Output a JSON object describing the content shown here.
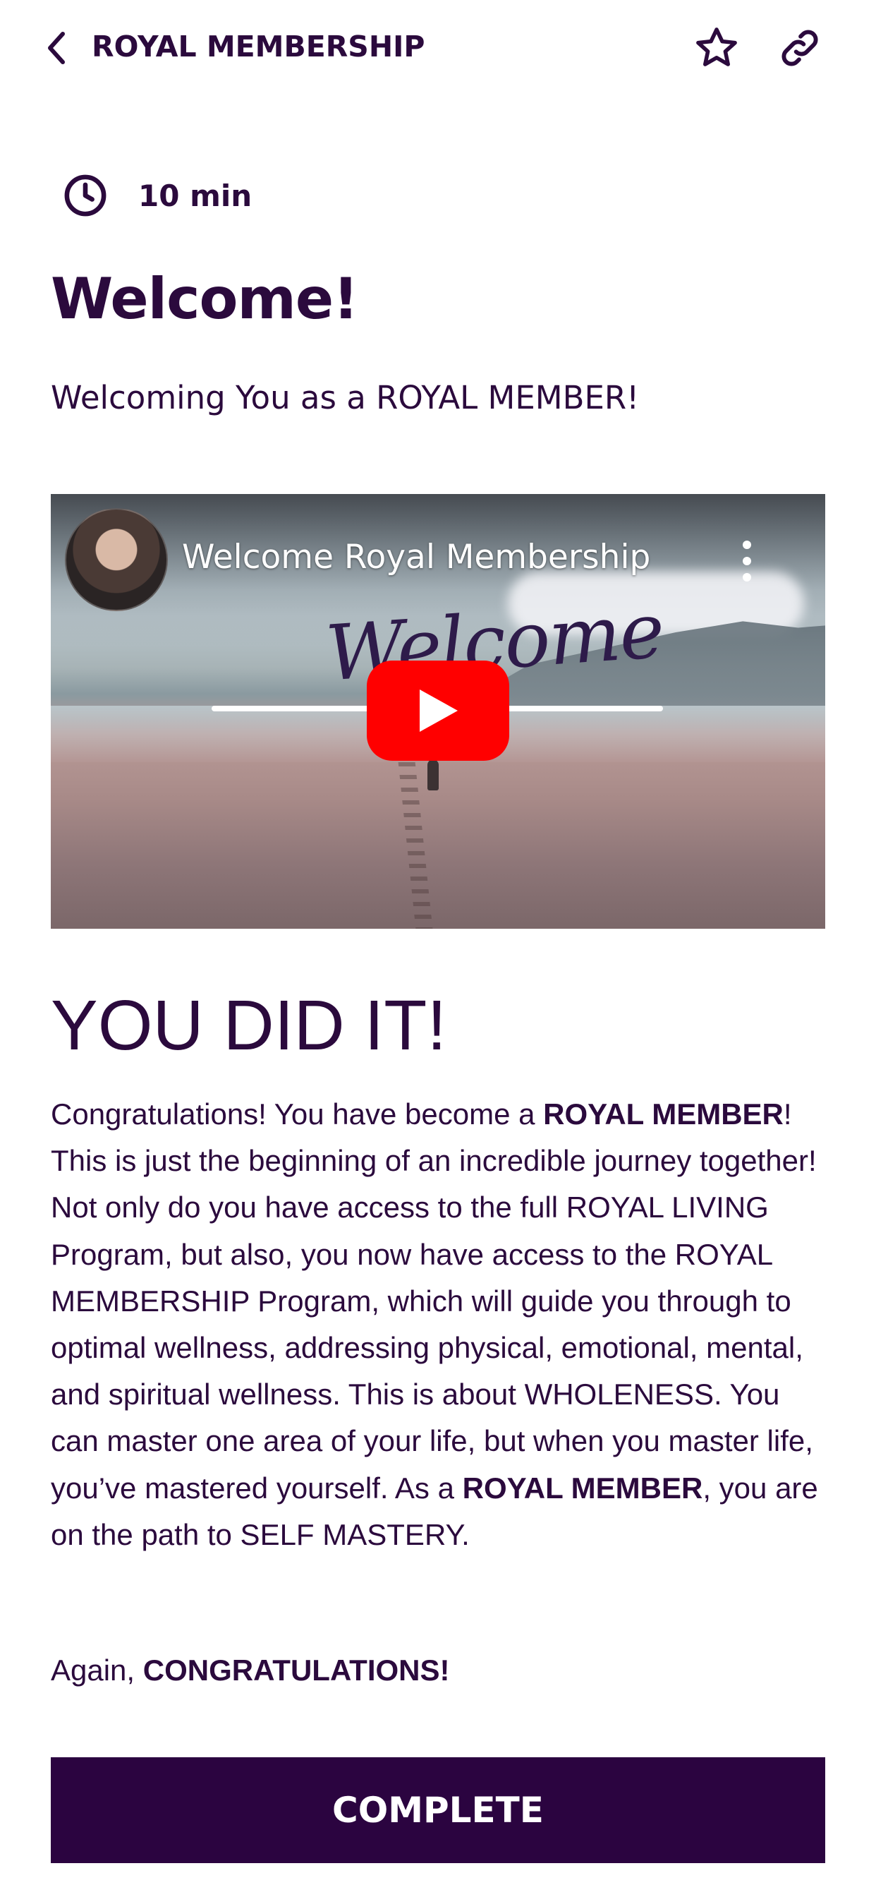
{
  "header": {
    "title": "ROYAL MEMBERSHIP"
  },
  "lesson": {
    "duration": "10 min",
    "title": "Welcome!",
    "subtitle": "Welcoming You as a ROYAL MEMBER!"
  },
  "video": {
    "title": "Welcome Royal Membership",
    "overlay_text": "Welcome"
  },
  "content": {
    "heading": "YOU DID IT!",
    "p1": "Congratulations! You have become a ",
    "b1": "ROYAL MEMBER",
    "p2": "! This is just the beginning of an incredible journey together! Not only do you have access to the full ROYAL LIVING Program, but also, you now have access to the ROYAL MEMBERSHIP Program, which will guide you through to optimal wellness, addressing physical, emotional, mental, and spiritual wellness. This is about WHOLENESS. You can master one area of your life, but when you master life, you’ve mastered yourself. As a ",
    "b2": "ROYAL MEMBER",
    "p3": ", you are on the path to SELF MASTERY.",
    "again_prefix": "Again, ",
    "again_bold": "CONGRATULATIONS!"
  },
  "actions": {
    "complete_label": "COMPLETE"
  },
  "colors": {
    "text": "#2b0a3d",
    "button_bg": "#2b0440",
    "play_red": "#ff0000"
  },
  "icons": [
    "chevron-left-icon",
    "star-icon",
    "link-icon",
    "clock-icon",
    "more-vertical-icon",
    "play-icon"
  ]
}
